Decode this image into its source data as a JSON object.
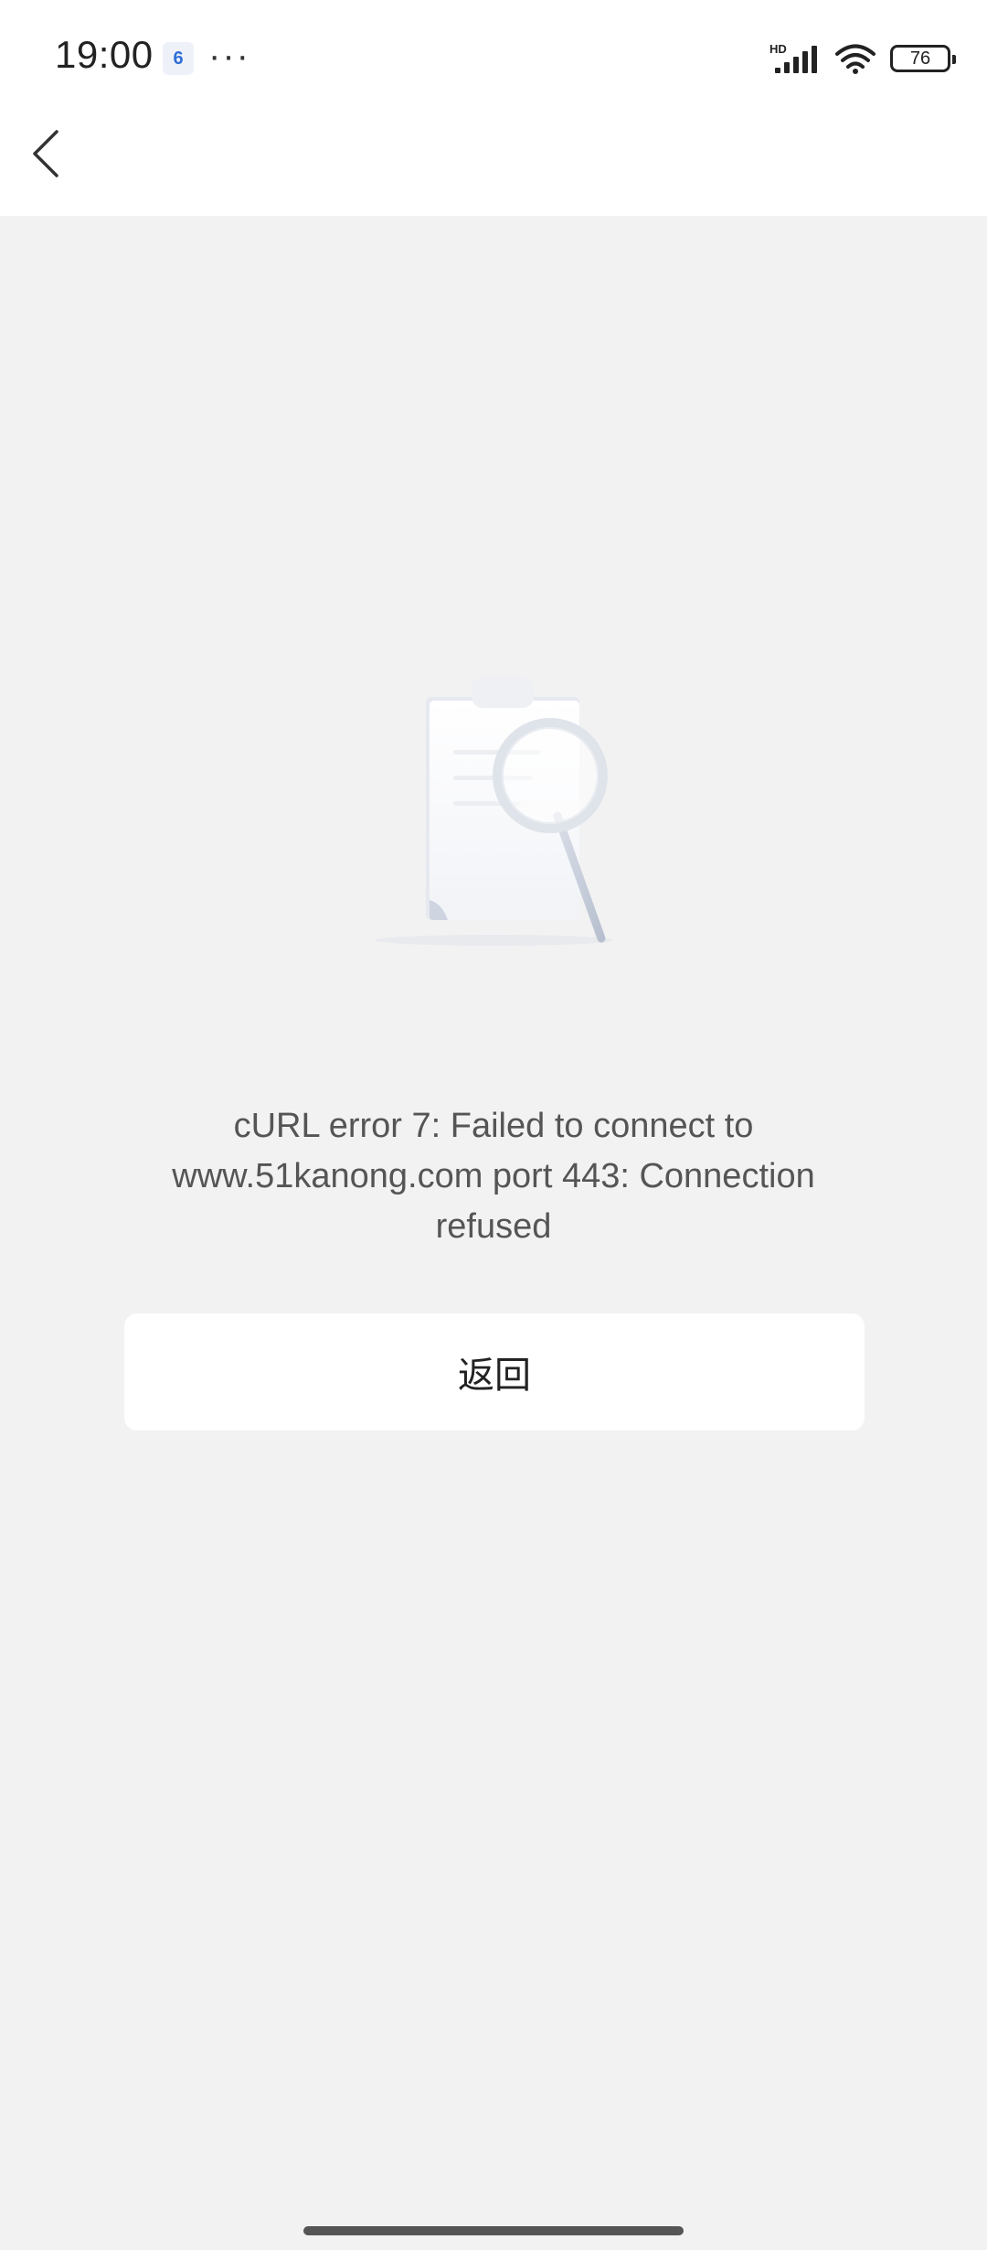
{
  "status_bar": {
    "time": "19:00",
    "notification_badge": "6",
    "more": "···",
    "network_type": "HD",
    "battery_level": "76"
  },
  "error": {
    "message": "cURL error 7: Failed to connect to www.51kanong.com port 443: Connection refused"
  },
  "actions": {
    "return_label": "返回"
  },
  "icons": {
    "back": "chevron-left-icon",
    "illustration": "document-search-icon",
    "signal": "signal-icon",
    "wifi": "wifi-icon",
    "battery": "battery-icon"
  },
  "colors": {
    "background": "#f2f2f3",
    "surface": "#ffffff",
    "text_primary": "#222222",
    "text_secondary": "#555555"
  }
}
